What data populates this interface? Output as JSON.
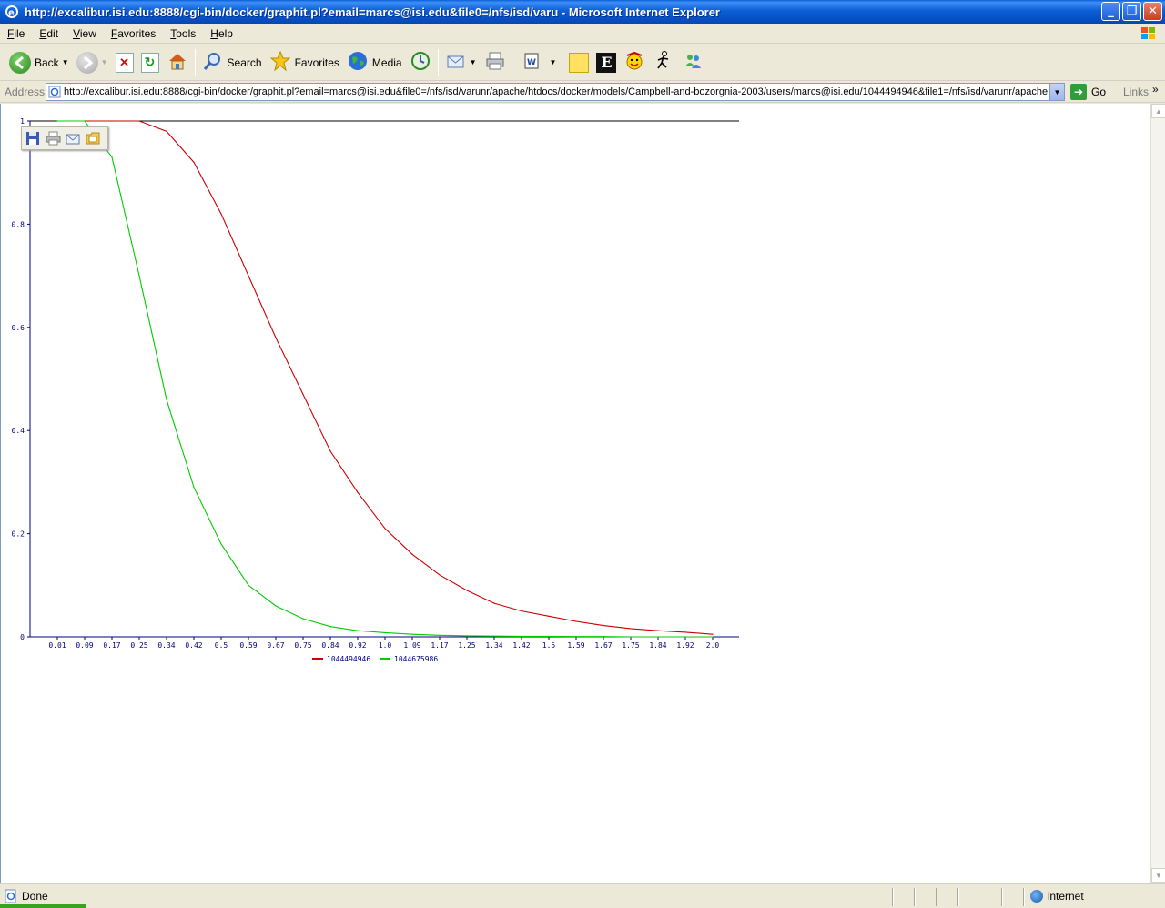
{
  "window": {
    "title": "http://excalibur.isi.edu:8888/cgi-bin/docker/graphit.pl?email=marcs@isi.edu&file0=/nfs/isd/varu - Microsoft Internet Explorer"
  },
  "menu": {
    "items": [
      "File",
      "Edit",
      "View",
      "Favorites",
      "Tools",
      "Help"
    ]
  },
  "toolbar": {
    "back_label": "Back",
    "search_label": "Search",
    "favorites_label": "Favorites",
    "media_label": "Media"
  },
  "address": {
    "label": "Address",
    "url": "http://excalibur.isi.edu:8888/cgi-bin/docker/graphit.pl?email=marcs@isi.edu&file0=/nfs/isd/varunr/apache/htdocs/docker/models/Campbell-and-bozorgnia-2003/users/marcs@isi.edu/1044494946&file1=/nfs/isd/varunr/apache",
    "go_label": "Go",
    "links_label": "Links"
  },
  "status": {
    "text": "Done",
    "zone": "Internet"
  },
  "chart_data": {
    "type": "line",
    "title": "",
    "xlabel": "",
    "ylabel": "",
    "x_ticks": [
      "0.01",
      "0.09",
      "0.17",
      "0.25",
      "0.34",
      "0.42",
      "0.5",
      "0.59",
      "0.67",
      "0.75",
      "0.84",
      "0.92",
      "1.0",
      "1.09",
      "1.17",
      "1.25",
      "1.34",
      "1.42",
      "1.5",
      "1.59",
      "1.67",
      "1.75",
      "1.84",
      "1.92",
      "2.0"
    ],
    "y_ticks": [
      "0",
      "0.2",
      "0.4",
      "0.6",
      "0.8",
      "1"
    ],
    "ylim": [
      0,
      1
    ],
    "legend_position": "bottom-center",
    "series": [
      {
        "name": "1044494946",
        "color": "#cc0000",
        "values": [
          1.0,
          1.0,
          1.0,
          1.0,
          0.98,
          0.92,
          0.82,
          0.7,
          0.58,
          0.47,
          0.36,
          0.28,
          0.21,
          0.16,
          0.12,
          0.09,
          0.065,
          0.05,
          0.04,
          0.03,
          0.022,
          0.016,
          0.012,
          0.009,
          0.005
        ]
      },
      {
        "name": "1044675986",
        "color": "#00cc00",
        "values": [
          1.0,
          1.0,
          0.93,
          0.7,
          0.46,
          0.29,
          0.18,
          0.1,
          0.06,
          0.035,
          0.02,
          0.012,
          0.008,
          0.005,
          0.003,
          0.002,
          0.0015,
          0.001,
          0.001,
          0.0005,
          0.0005,
          0.0,
          0.0,
          0.0,
          0.0
        ]
      }
    ]
  }
}
